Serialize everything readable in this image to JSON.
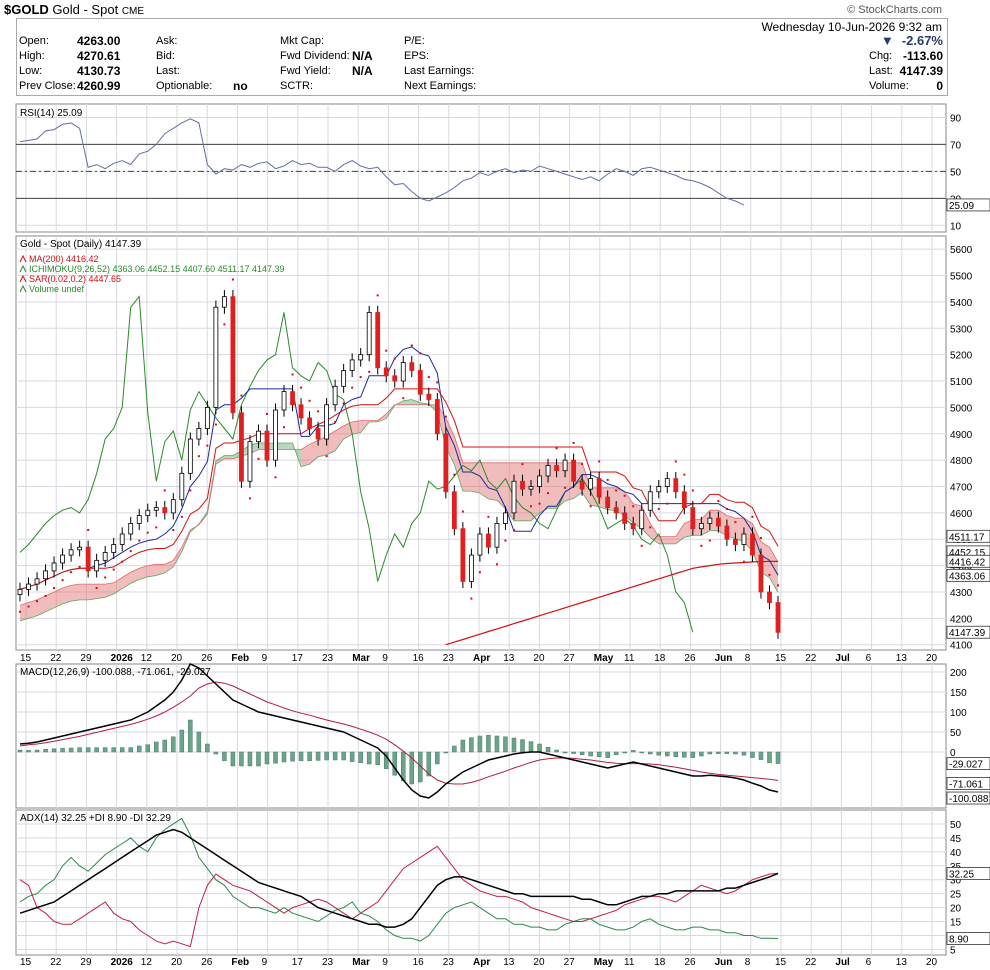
{
  "header": {
    "symbol": "$GOLD",
    "name": "Gold - Spot",
    "exchange": "CME",
    "source": "© StockCharts.com",
    "datetime": "Wednesday  10-Jun-2026  9:32 am"
  },
  "quote": {
    "open_label": "Open:",
    "open": "4263.00",
    "high_label": "High:",
    "high": "4270.61",
    "low_label": "Low:",
    "low": "4130.73",
    "prev_label": "Prev Close:",
    "prev": "4260.99",
    "ask_label": "Ask:",
    "bid_label": "Bid:",
    "last_label": "Last:",
    "optionable_label": "Optionable:",
    "optionable": "no",
    "mktcap_label": "Mkt Cap:",
    "fwd_div_label": "Fwd Dividend:",
    "fwd_div": "N/A",
    "fwd_yield_label": "Fwd Yield:",
    "fwd_yield": "N/A",
    "sctr_label": "SCTR:",
    "pe_label": "P/E:",
    "eps_label": "EPS:",
    "last_earn_label": "Last Earnings:",
    "next_earn_label": "Next Earnings:",
    "pct_change": "-2.67%",
    "chg_label": "Chg:",
    "chg": "-113.60",
    "last2_label": "Last:",
    "last": "4147.39",
    "volume_label": "Volume:",
    "volume": "0"
  },
  "colors": {
    "up": "#ffffff",
    "down": "#e02020",
    "grid": "#d8d8e0",
    "panel_bg": "#f5f5f8",
    "tenkan": "#1a2a9a",
    "kijun": "#d01010",
    "chikou": "#2a8a2a",
    "cloud_up": "#5fa86a",
    "cloud_down": "#e06a6a",
    "ma200": "#d01010",
    "sar": "#d01010",
    "rsi": "#6070a0",
    "macd": "#000000",
    "signal": "#b0203a",
    "hist": "#6aa58a",
    "adx": "#000000",
    "pdi": "#2a8a4a",
    "mdi": "#c02040"
  },
  "chart_data": [
    {
      "type": "line",
      "title": "RSI(14) 25.09",
      "ylim": [
        5,
        100
      ],
      "yticks": [
        "90",
        "70",
        "50",
        "30",
        "10"
      ],
      "last_label": "25.09",
      "values": [
        72,
        73,
        74,
        80,
        81,
        85,
        86,
        82,
        53,
        55,
        52,
        56,
        58,
        55,
        63,
        65,
        70,
        78,
        82,
        86,
        89,
        86,
        55,
        48,
        52,
        51,
        55,
        53,
        56,
        57,
        52,
        54,
        58,
        55,
        56,
        53,
        53,
        50,
        55,
        58,
        54,
        52,
        53,
        46,
        40,
        41,
        35,
        30,
        28,
        31,
        34,
        38,
        43,
        45,
        49,
        47,
        50,
        52,
        49,
        51,
        50,
        54,
        52,
        50,
        48,
        46,
        44,
        46,
        43,
        48,
        52,
        50,
        47,
        52,
        53,
        51,
        49,
        47,
        44,
        43,
        41,
        38,
        34,
        30,
        28,
        25
      ]
    },
    {
      "type": "candlestick",
      "title": "Gold - Spot (Daily) 4147.39",
      "legend": [
        "MA(200) 4416.42",
        "ICHIMOKU(9,26,52) 4363.06  4452.15  4407.60  4511.17  4147.39",
        "SAR(0.02,0.2) 4447.65",
        "Volume undef"
      ],
      "ylim": [
        4080,
        5650
      ],
      "yticks": [
        "5600",
        "5500",
        "5400",
        "5300",
        "5200",
        "5100",
        "5000",
        "4900",
        "4800",
        "4700",
        "4600",
        "4500",
        "4400",
        "4300",
        "4200",
        "4100"
      ],
      "right_labels": [
        "4511.17",
        "4452.15",
        "4416.42",
        "4363.06",
        "4147.39"
      ],
      "x_labels": [
        "15",
        "22",
        "29",
        "2026",
        "12",
        "20",
        "26",
        "Feb",
        "9",
        "17",
        "23",
        "Mar",
        "9",
        "16",
        "23",
        "Apr",
        "13",
        "20",
        "27",
        "May",
        "11",
        "18",
        "26",
        "Jun",
        "8",
        "15",
        "22",
        "Jul",
        "6",
        "13",
        "20"
      ],
      "closes": [
        4310,
        4330,
        4350,
        4380,
        4410,
        4440,
        4460,
        4470,
        4380,
        4420,
        4450,
        4480,
        4520,
        4560,
        4590,
        4610,
        4620,
        4600,
        4650,
        4750,
        4880,
        4920,
        5000,
        5380,
        5420,
        4980,
        4720,
        4870,
        4910,
        4800,
        4990,
        5060,
        5010,
        4960,
        4920,
        4880,
        5010,
        5080,
        5140,
        5180,
        5200,
        5360,
        5150,
        5120,
        5100,
        5170,
        5140,
        5050,
        5030,
        4900,
        4680,
        4540,
        4340,
        4440,
        4520,
        4470,
        4560,
        4600,
        4720,
        4690,
        4700,
        4740,
        4780,
        4760,
        4800,
        4720,
        4690,
        4730,
        4660,
        4620,
        4600,
        4560,
        4540,
        4610,
        4680,
        4700,
        4730,
        4680,
        4620,
        4540,
        4560,
        4580,
        4550,
        4500,
        4480,
        4520,
        4440,
        4300,
        4260,
        4147
      ],
      "ma200": [
        null,
        null,
        null,
        null,
        null,
        null,
        null,
        null,
        null,
        null,
        null,
        null,
        null,
        null,
        null,
        null,
        null,
        null,
        null,
        null,
        null,
        null,
        null,
        null,
        null,
        null,
        null,
        null,
        null,
        null,
        null,
        null,
        null,
        null,
        null,
        null,
        null,
        null,
        null,
        null,
        null,
        null,
        null,
        null,
        null,
        null,
        null,
        null,
        null,
        null,
        4100,
        4110,
        4120,
        4130,
        4140,
        4150,
        4160,
        4170,
        4180,
        4190,
        4200,
        4210,
        4220,
        4230,
        4240,
        4250,
        4260,
        4270,
        4280,
        4290,
        4300,
        4310,
        4320,
        4330,
        4340,
        4350,
        4360,
        4370,
        4380,
        4390,
        4395,
        4400,
        4405,
        4408,
        4410,
        4412,
        4414,
        4415,
        4416,
        4416.42
      ]
    },
    {
      "type": "line",
      "title": "MACD(12,26,9) -100.088, -71.061, -29.027",
      "ylim": [
        -140,
        220
      ],
      "yticks": [
        "200",
        "150",
        "100",
        "50",
        "0"
      ],
      "right_labels": [
        "-29.027",
        "-71.061",
        "-100.088"
      ],
      "macd": [
        20,
        22,
        25,
        30,
        35,
        40,
        45,
        50,
        55,
        60,
        65,
        70,
        75,
        80,
        90,
        100,
        115,
        130,
        150,
        180,
        220,
        210,
        190,
        170,
        150,
        130,
        120,
        110,
        100,
        95,
        90,
        85,
        80,
        75,
        70,
        65,
        60,
        55,
        50,
        40,
        30,
        20,
        10,
        -10,
        -40,
        -70,
        -95,
        -110,
        -115,
        -100,
        -80,
        -65,
        -50,
        -40,
        -30,
        -20,
        -15,
        -10,
        -5,
        -2,
        0,
        0,
        -5,
        -10,
        -15,
        -20,
        -25,
        -30,
        -35,
        -40,
        -35,
        -30,
        -25,
        -30,
        -35,
        -40,
        -45,
        -50,
        -55,
        -60,
        -60,
        -58,
        -60,
        -62,
        -65,
        -70,
        -78,
        -85,
        -95,
        -100.088
      ],
      "signal": [
        15,
        18,
        20,
        23,
        27,
        31,
        35,
        39,
        44,
        49,
        54,
        59,
        64,
        69,
        75,
        82,
        90,
        100,
        112,
        125,
        140,
        160,
        170,
        175,
        172,
        165,
        155,
        145,
        135,
        125,
        118,
        110,
        103,
        97,
        92,
        86,
        80,
        75,
        70,
        64,
        57,
        50,
        42,
        32,
        18,
        2,
        -15,
        -35,
        -55,
        -70,
        -78,
        -80,
        -80,
        -76,
        -70,
        -62,
        -55,
        -48,
        -40,
        -33,
        -26,
        -20,
        -17,
        -15,
        -15,
        -16,
        -18,
        -20,
        -23,
        -26,
        -28,
        -29,
        -29,
        -29,
        -30,
        -32,
        -35,
        -38,
        -42,
        -46,
        -50,
        -53,
        -56,
        -58,
        -60,
        -62,
        -64,
        -66,
        -68,
        -71.061
      ],
      "histogram": [
        5,
        4,
        5,
        7,
        8,
        9,
        10,
        11,
        11,
        11,
        11,
        11,
        11,
        11,
        15,
        18,
        25,
        30,
        38,
        55,
        80,
        50,
        20,
        -5,
        -22,
        -35,
        -35,
        -35,
        -35,
        -30,
        -28,
        -25,
        -23,
        -22,
        -22,
        -21,
        -20,
        -20,
        -20,
        -24,
        -27,
        -30,
        -32,
        -42,
        -58,
        -72,
        -80,
        -75,
        -60,
        -30,
        -2,
        15,
        30,
        36,
        40,
        42,
        40,
        38,
        35,
        31,
        26,
        20,
        12,
        5,
        0,
        -4,
        -7,
        -10,
        -12,
        -14,
        -7,
        -1,
        4,
        -1,
        -5,
        -8,
        -10,
        -12,
        -13,
        -14,
        -10,
        -5,
        -4,
        -4,
        -5,
        -8,
        -14,
        -19,
        -27,
        -29.027
      ]
    },
    {
      "type": "line",
      "title": "ADX(14) 32.25 +DI 8.90 -DI 32.29",
      "ylim": [
        3,
        55
      ],
      "yticks": [
        "50",
        "45",
        "40",
        "35",
        "30",
        "25",
        "20",
        "15",
        "10",
        "5"
      ],
      "right_labels": [
        "32.25",
        "8.90"
      ],
      "adx": [
        18,
        19,
        20,
        21,
        22,
        24,
        26,
        28,
        30,
        32,
        34,
        36,
        38,
        40,
        42,
        44,
        46,
        47,
        48,
        47,
        45,
        43,
        41,
        39,
        37,
        35,
        33,
        31,
        29,
        28,
        27,
        26,
        25,
        24,
        22,
        20,
        19,
        18,
        17,
        16,
        15,
        14,
        14,
        13,
        13,
        14,
        16,
        20,
        24,
        28,
        30,
        31,
        31,
        30,
        29,
        28,
        27,
        26,
        25,
        25,
        24,
        24,
        24,
        24,
        24,
        24,
        23,
        23,
        22,
        21,
        21,
        22,
        23,
        24,
        24,
        25,
        25,
        26,
        26,
        26,
        26,
        26,
        26,
        27,
        27,
        28,
        29,
        30,
        31,
        32.25
      ],
      "plus_di": [
        22,
        24,
        25,
        28,
        30,
        35,
        38,
        35,
        33,
        36,
        39,
        41,
        43,
        45,
        42,
        40,
        45,
        48,
        50,
        52,
        46,
        38,
        34,
        30,
        28,
        24,
        22,
        20,
        20,
        19,
        18,
        20,
        18,
        17,
        16,
        15,
        17,
        19,
        20,
        22,
        18,
        17,
        15,
        12,
        10,
        9,
        9,
        8,
        10,
        14,
        18,
        20,
        21,
        22,
        20,
        18,
        16,
        16,
        14,
        14,
        13,
        13,
        12,
        12,
        14,
        15,
        16,
        16,
        14,
        13,
        12,
        12,
        13,
        15,
        16,
        14,
        13,
        12,
        12,
        13,
        13,
        12,
        12,
        11,
        11,
        10,
        10,
        9,
        9,
        8.9
      ],
      "minus_di": [
        30,
        28,
        20,
        18,
        15,
        14,
        14,
        16,
        18,
        20,
        22,
        18,
        16,
        15,
        12,
        10,
        8,
        7,
        8,
        7,
        6,
        20,
        28,
        32,
        30,
        28,
        27,
        26,
        24,
        22,
        20,
        18,
        20,
        21,
        22,
        23,
        22,
        20,
        18,
        16,
        18,
        20,
        22,
        26,
        30,
        34,
        36,
        38,
        40,
        42,
        38,
        34,
        30,
        28,
        26,
        25,
        24,
        24,
        23,
        22,
        20,
        19,
        18,
        17,
        16,
        15,
        15,
        16,
        17,
        18,
        19,
        21,
        22,
        23,
        24,
        24,
        23,
        22,
        24,
        26,
        28,
        27,
        26,
        25,
        26,
        28,
        30,
        31,
        32,
        32.29
      ]
    }
  ]
}
